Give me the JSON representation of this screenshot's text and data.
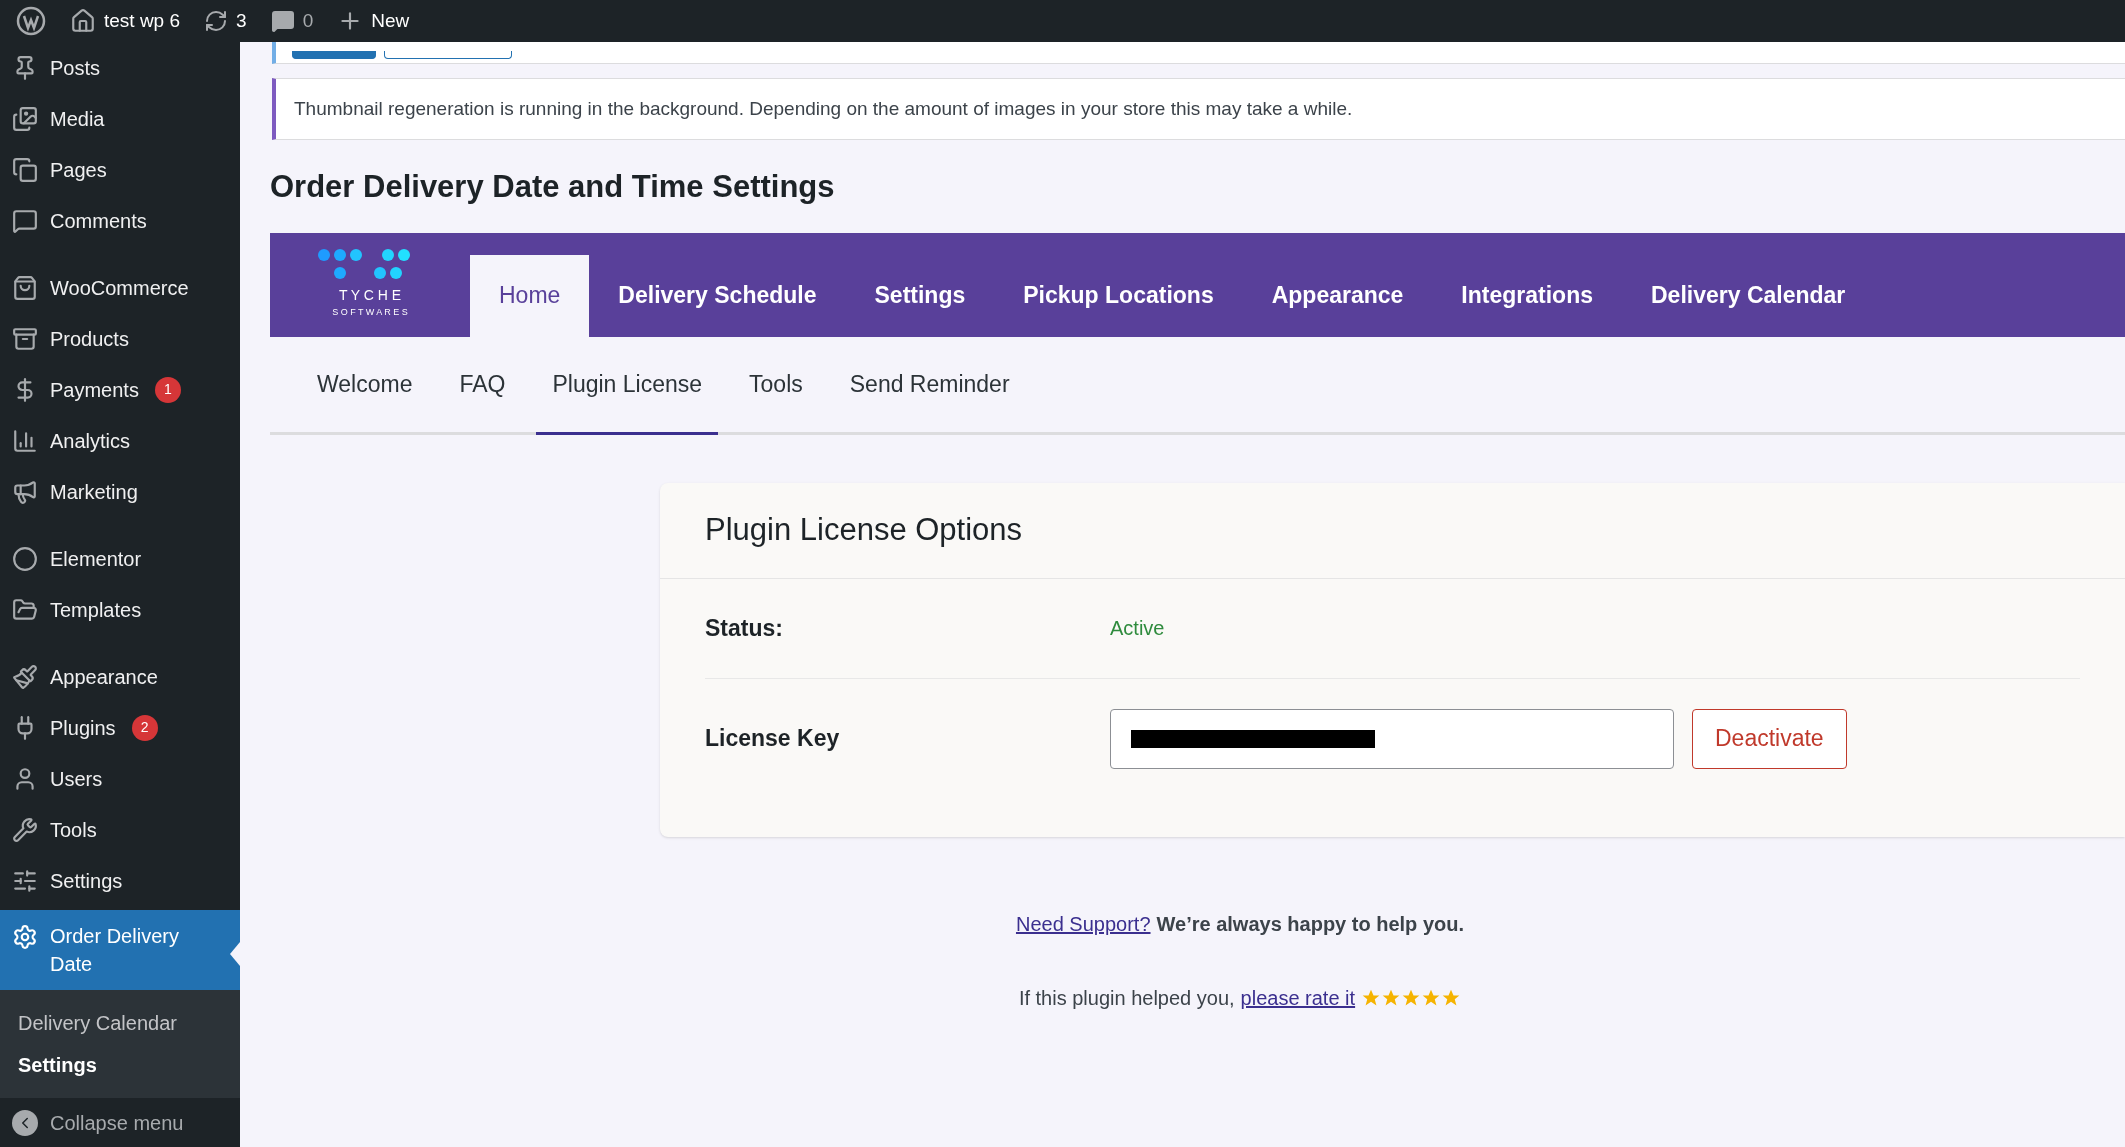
{
  "admin_bar": {
    "site": "test wp 6",
    "updates": "3",
    "comments": "0",
    "new": "New"
  },
  "sidebar": {
    "groups": [
      [
        {
          "label": "Posts"
        },
        {
          "label": "Media"
        },
        {
          "label": "Pages"
        },
        {
          "label": "Comments"
        }
      ],
      [
        {
          "label": "WooCommerce"
        },
        {
          "label": "Products"
        },
        {
          "label": "Payments",
          "badge": "1"
        },
        {
          "label": "Analytics"
        },
        {
          "label": "Marketing"
        }
      ],
      [
        {
          "label": "Elementor"
        },
        {
          "label": "Templates"
        }
      ],
      [
        {
          "label": "Appearance"
        },
        {
          "label": "Plugins",
          "badge": "2"
        },
        {
          "label": "Users"
        },
        {
          "label": "Tools"
        },
        {
          "label": "Settings"
        }
      ]
    ],
    "active": {
      "label": "Order Delivery Date",
      "submenu": [
        {
          "label": "Delivery Calendar",
          "selected": false
        },
        {
          "label": "Settings",
          "selected": true
        }
      ]
    },
    "collapse": "Collapse menu"
  },
  "notice": "Thumbnail regeneration is running in the background. Depending on the amount of images in your store this may take a while.",
  "page_title": "Order Delivery Date and Time Settings",
  "logo": {
    "name": "T Y C H E",
    "sub": "S O F T W A R E S"
  },
  "main_tabs": [
    {
      "label": "Home",
      "selected": true
    },
    {
      "label": "Delivery Schedule",
      "selected": false
    },
    {
      "label": "Settings",
      "selected": false
    },
    {
      "label": "Pickup Locations",
      "selected": false
    },
    {
      "label": "Appearance",
      "selected": false
    },
    {
      "label": "Integrations",
      "selected": false
    },
    {
      "label": "Delivery Calendar",
      "selected": false
    }
  ],
  "sub_tabs": [
    {
      "label": "Welcome",
      "selected": false
    },
    {
      "label": "FAQ",
      "selected": false
    },
    {
      "label": "Plugin License",
      "selected": true
    },
    {
      "label": "Tools",
      "selected": false
    },
    {
      "label": "Send Reminder",
      "selected": false
    }
  ],
  "card": {
    "title": "Plugin License Options",
    "status_label": "Status:",
    "status": "Active",
    "key_label": "License Key",
    "key_redacted": true,
    "button": "Deactivate"
  },
  "support": {
    "link": "Need Support?",
    "text": "We’re always happy to help you."
  },
  "rate": {
    "text": "If this plugin helped you,",
    "link": "please rate it",
    "stars": 5
  }
}
